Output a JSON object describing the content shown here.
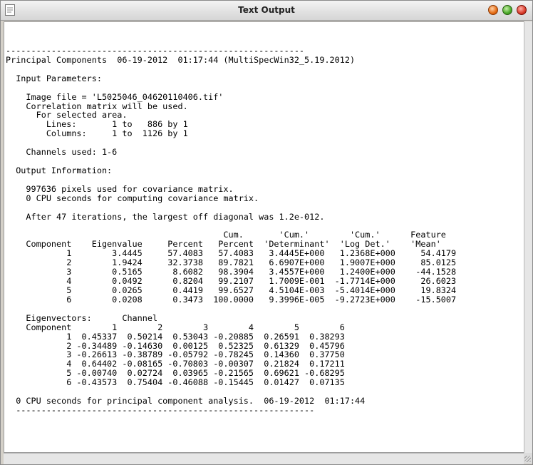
{
  "window": {
    "title": "Text Output",
    "icon": "text-document-icon"
  },
  "output": {
    "lines": [
      "-----------------------------------------------------------",
      "Principal Components  06-19-2012  01:17:44 (MultiSpecWin32_5.19.2012)",
      "",
      "  Input Parameters:",
      "",
      "    Image file = 'L5025046_04620110406.tif'",
      "    Correlation matrix will be used.",
      "      For selected area.",
      "        Lines:       1 to   886 by 1",
      "        Columns:     1 to  1126 by 1",
      "",
      "    Channels used: 1-6",
      "",
      "  Output Information:",
      "",
      "    997636 pixels used for covariance matrix.",
      "    0 CPU seconds for computing covariance matrix.",
      "",
      "    After 47 iterations, the largest off diagonal was 1.2e-012.",
      "",
      "                                           Cum.       'Cum.'        'Cum.'      Feature",
      "    Component    Eigenvalue     Percent   Percent  'Determinant'  'Log Det.'    'Mean'",
      "            1        3.4445     57.4083   57.4083   3.4445E+000   1.2368E+000     54.4179",
      "            2        1.9424     32.3738   89.7821   6.6907E+000   1.9007E+000     85.0125",
      "            3        0.5165      8.6082   98.3904   3.4557E+000   1.2400E+000    -44.1528",
      "            4        0.0492      0.8204   99.2107   1.7009E-001  -1.7714E+000     26.6023",
      "            5        0.0265      0.4419   99.6527   4.5104E-003  -5.4014E+000     19.8324",
      "            6        0.0208      0.3473  100.0000   9.3996E-005  -9.2723E+000    -15.5007",
      "",
      "    Eigenvectors:      Channel",
      "    Component        1        2        3        4        5        6",
      "            1  0.45337  0.50214  0.53043 -0.20885  0.26591  0.38293",
      "            2 -0.34489 -0.14630  0.00125  0.52325  0.61329  0.45796",
      "            3 -0.26613 -0.38789 -0.05792 -0.78245  0.14360  0.37750",
      "            4  0.64402 -0.08165 -0.70803 -0.00307  0.21824  0.17211",
      "            5 -0.00740  0.02724  0.03965 -0.21565  0.69621 -0.68295",
      "            6 -0.43573  0.75404 -0.46088 -0.15445  0.01427  0.07135",
      "",
      "  0 CPU seconds for principal component analysis.  06-19-2012  01:17:44",
      "  -----------------------------------------------------------"
    ]
  }
}
